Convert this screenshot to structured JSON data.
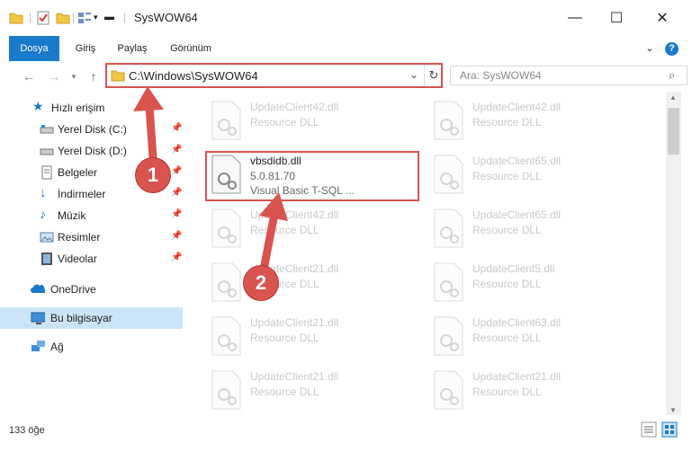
{
  "window": {
    "title": "SysWOW64",
    "controls": {
      "minimize": "—",
      "maximize": "☐",
      "close": "✕"
    }
  },
  "ribbon": {
    "tabs": [
      "Dosya",
      "Giriş",
      "Paylaş",
      "Görünüm"
    ]
  },
  "address": {
    "path": "C:\\Windows\\SysWOW64",
    "search_placeholder": "Ara: SysWOW64"
  },
  "sidebar": {
    "items": [
      {
        "label": "Hızlı erişim",
        "icon": "star-icon"
      },
      {
        "label": "Yerel Disk (C:)",
        "icon": "drive-icon",
        "pinned": true
      },
      {
        "label": "Yerel Disk (D:)",
        "icon": "drive-icon",
        "pinned": true
      },
      {
        "label": "Belgeler",
        "icon": "documents-icon",
        "pinned": true
      },
      {
        "label": "İndirmeler",
        "icon": "download-icon",
        "pinned": true
      },
      {
        "label": "Müzik",
        "icon": "music-icon",
        "pinned": true
      },
      {
        "label": "Resimler",
        "icon": "pictures-icon",
        "pinned": true
      },
      {
        "label": "Videolar",
        "icon": "videos-icon",
        "pinned": true
      },
      {
        "label": "OneDrive",
        "icon": "onedrive-icon"
      },
      {
        "label": "Bu bilgisayar",
        "icon": "computer-icon",
        "selected": true
      },
      {
        "label": "Ağ",
        "icon": "network-icon"
      }
    ]
  },
  "files": {
    "left": [
      {
        "name": "UpdateClient42.dll",
        "sub": "Resource DLL",
        "faded": true
      },
      {
        "name": "vbsdidb.dll",
        "version": "5.0.81.70",
        "sub": "Visual Basic T-SQL ...",
        "faded": false
      },
      {
        "name": "UpdateClient42.dll",
        "sub": "Resource DLL",
        "faded": true
      },
      {
        "name": "UpdateClient21.dll",
        "sub": "Resource DLL",
        "faded": true
      },
      {
        "name": "UpdateClient21.dll",
        "sub": "Resource DLL",
        "faded": true
      },
      {
        "name": "UpdateClient21.dll",
        "sub": "Resource DLL",
        "faded": true
      }
    ],
    "right": [
      {
        "name": "UpdateClient42.dll",
        "sub": "Resource DLL",
        "faded": true
      },
      {
        "name": "UpdateClient65.dll",
        "sub": "Resource DLL",
        "faded": true
      },
      {
        "name": "UpdateClient65.dll",
        "sub": "Resource DLL",
        "faded": true
      },
      {
        "name": "UpdateClient5.dll",
        "sub": "Resource DLL",
        "faded": true
      },
      {
        "name": "UpdateClient63.dll",
        "sub": "Resource DLL",
        "faded": true
      },
      {
        "name": "UpdateClient21.dll",
        "sub": "Resource DLL",
        "faded": true
      }
    ]
  },
  "status": {
    "count": "133 öğe"
  },
  "annotations": {
    "step1": "1",
    "step2": "2",
    "color": "#d9534f"
  }
}
